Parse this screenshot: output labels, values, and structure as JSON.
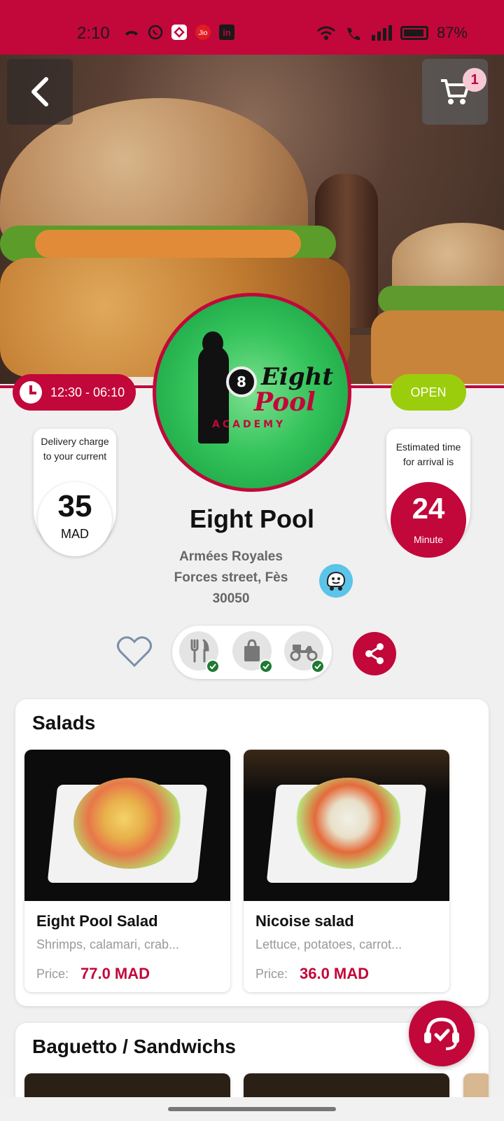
{
  "status_bar": {
    "time": "2:10",
    "battery": "87%",
    "notification_icons": [
      "missed-call-icon",
      "whatsapp-icon",
      "app-icon",
      "jio-icon",
      "linkedin-icon"
    ],
    "system_icons": [
      "wifi-icon",
      "wifi-call-icon",
      "signal-icon",
      "battery-icon"
    ]
  },
  "header": {
    "cart_count": "1"
  },
  "restaurant": {
    "hours": "12:30 - 06:10",
    "status": "OPEN",
    "name": "Eight Pool",
    "address_line1": "Armées Royales",
    "address_line2": "Forces street, Fès",
    "address_line3": "30050",
    "logo": {
      "ball": "8",
      "line1": "Eight",
      "line2": "Pool",
      "line3": "ACADEMY"
    }
  },
  "delivery": {
    "label": "Delivery charge to your current",
    "value": "35",
    "unit": "MAD"
  },
  "eta": {
    "label": "Estimated time for arrival is",
    "value": "24",
    "unit": "Minute"
  },
  "services": [
    "dine-in-icon",
    "takeaway-icon",
    "delivery-icon"
  ],
  "sections": [
    {
      "title": "Salads",
      "items": [
        {
          "name": "Eight Pool Salad",
          "desc": "Shrimps, calamari, crab...",
          "price_label": "Price:",
          "price": "77.0 MAD"
        },
        {
          "name": "Nicoise salad",
          "desc": "Lettuce, potatoes, carrot...",
          "price_label": "Price:",
          "price": "36.0 MAD"
        }
      ]
    },
    {
      "title": "Baguetto / Sandwichs",
      "items": []
    }
  ],
  "colors": {
    "brand": "#c2073a",
    "open": "#9bcd0c",
    "check": "#1f7a32"
  }
}
